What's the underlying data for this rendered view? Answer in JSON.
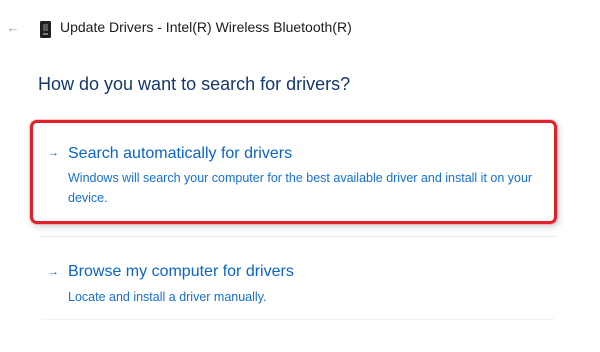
{
  "window": {
    "title": "Update Drivers - Intel(R) Wireless Bluetooth(R)",
    "back_icon": "back-arrow-icon",
    "device_icon": "device-icon"
  },
  "page": {
    "heading": "How do you want to search for drivers?"
  },
  "options": [
    {
      "title": "Search automatically for drivers",
      "description": "Windows will search your computer for the best available driver and install it on your device.",
      "icon": "arrow-right-icon",
      "highlighted": true
    },
    {
      "title": "Browse my computer for drivers",
      "description": "Locate and install a driver manually.",
      "icon": "arrow-right-icon",
      "highlighted": false
    }
  ],
  "colors": {
    "heading": "#16386f",
    "link": "#0a64c6",
    "highlight": "#e0202a",
    "title_text": "#1b1b1b"
  }
}
